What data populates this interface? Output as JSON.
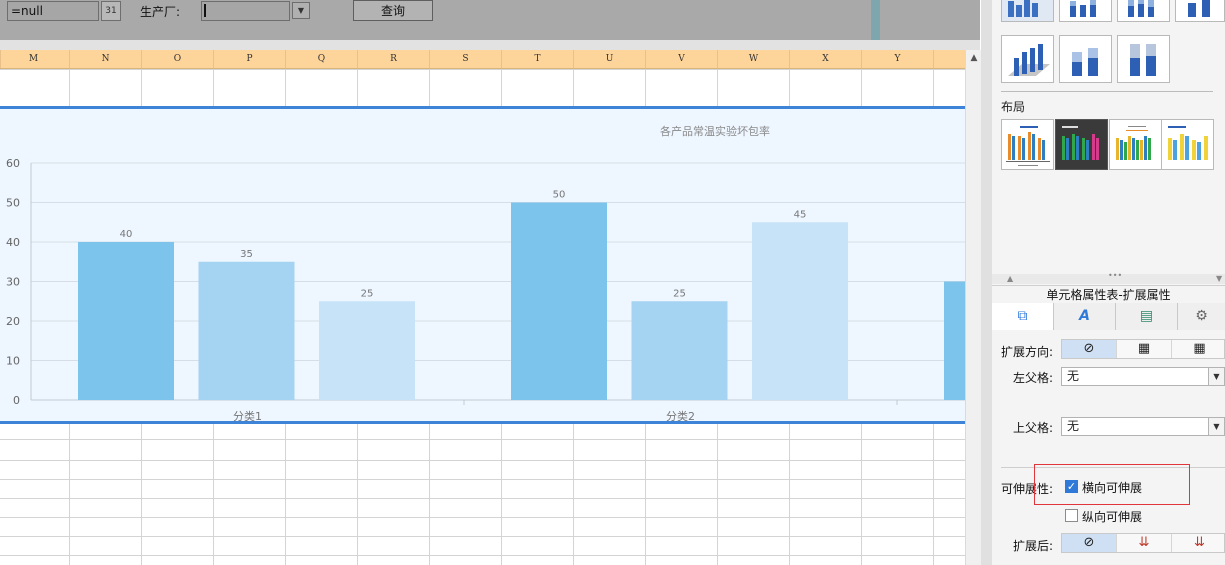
{
  "toolbar": {
    "date_value": "=null",
    "calendar_icon_text": "31",
    "factory_label": "生产厂:",
    "factory_value": "",
    "query_button": "查询"
  },
  "columns": [
    "M",
    "N",
    "O",
    "P",
    "Q",
    "R",
    "S",
    "T",
    "U",
    "V",
    "W",
    "X",
    "Y"
  ],
  "chart_data": {
    "type": "bar",
    "title": "各产品常温实验坏包率",
    "categories": [
      "分类1",
      "分类2"
    ],
    "series": [
      {
        "values": [
          40,
          50
        ],
        "color": "#7dc4ec"
      },
      {
        "values": [
          35,
          25
        ],
        "color": "#a5d3f2"
      },
      {
        "values": [
          25,
          45
        ],
        "color": "#c7e3f8"
      }
    ],
    "partial_next_value": 30,
    "y_ticks": [
      0,
      10,
      20,
      30,
      40,
      50,
      60
    ],
    "ylim": [
      0,
      60
    ],
    "grid": true,
    "colors": {
      "background": "#eef6ff",
      "gridline": "#d7dde4",
      "frame": "#3d84d8"
    }
  },
  "right_panel": {
    "layout_title": "布局",
    "property_title": "单元格属性表-扩展属性",
    "tabs": [
      "cell-expand-icon",
      "font-style-icon",
      "style-icon",
      "gear-icon"
    ],
    "tab_glyphs": [
      "⧉",
      "A",
      "▤",
      "⚙"
    ],
    "expand_direction_label": "扩展方向:",
    "expand_direction_glyphs": [
      "⊘",
      "▦",
      "▦"
    ],
    "left_parent_label": "左父格:",
    "left_parent_value": "无",
    "top_parent_label": "上父格:",
    "top_parent_value": "无",
    "stretch_label": "可伸展性:",
    "stretch_horizontal": {
      "label": "横向可伸展",
      "checked": true
    },
    "stretch_vertical": {
      "label": "纵向可伸展",
      "checked": false
    },
    "after_expand_label": "扩展后:",
    "after_expand_glyphs": [
      "⊘",
      "⇊",
      "⇊"
    ],
    "accent_color": "#e0353a"
  }
}
